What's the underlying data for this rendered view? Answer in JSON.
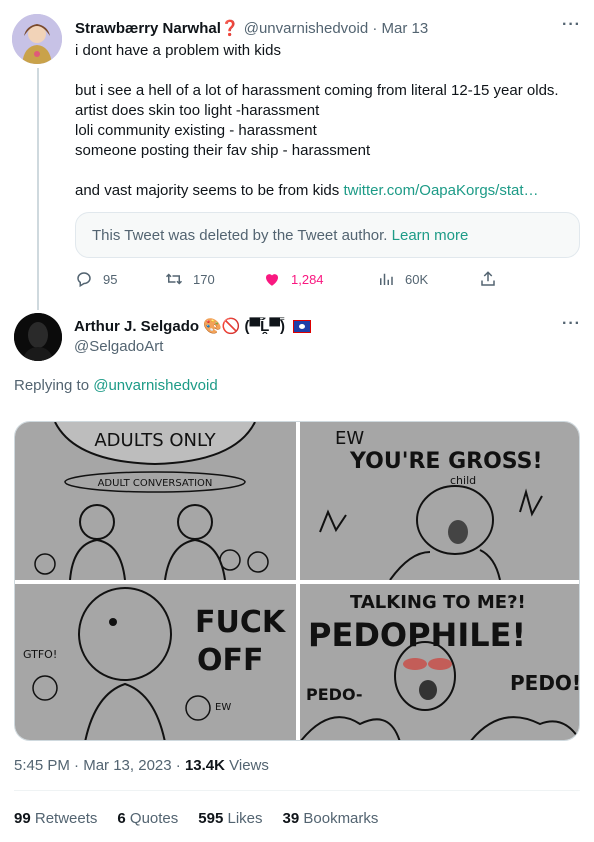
{
  "parent_tweet": {
    "display_name": "Strawbærry Narwhal❓",
    "handle": "@unvarnishedvoid",
    "separator": "·",
    "date": "Mar 13",
    "more_icon": "more-icon",
    "lines": [
      "i dont have a problem with kids",
      "",
      "but i see a hell of a lot of harassment coming from literal 12-15 year olds.",
      "artist does skin too light -harassment",
      "loli community existing - harassment",
      "someone posting their fav ship - harassment",
      ""
    ],
    "last_line_text": "and vast majority seems to be from kids ",
    "last_line_link": "twitter.com/OapaKorgs/stat…",
    "deleted_notice": "This Tweet was deleted by the Tweet author.",
    "learn_more": "Learn more",
    "actions": {
      "replies": "95",
      "retweets": "170",
      "likes": "1,284",
      "views": "60K"
    }
  },
  "main_tweet": {
    "display_name": "Arthur J. Selgado",
    "name_emoji": "🎨🚫 (▀̿Ĺ̯▀̿)",
    "handle": "@SelgadoArt",
    "replying_prefix": "Replying to ",
    "replying_handle": "@unvarnishedvoid",
    "comic_text": {
      "p1_bubble": "ADULTS ONLY",
      "p1_label": "ADULT CONVERSATION",
      "p2_top": "EW",
      "p2_shout": "YOU'RE GROSS!",
      "p2_child": "child",
      "p3_shout_1": "FUCK",
      "p3_shout_2": "OFF",
      "p3_small": "GTFO!",
      "p3_ew": "EW",
      "p4_top": "TALKING TO ME?!",
      "p4_mid": "PEDOPHILE!",
      "p4_left": "PEDO-",
      "p4_right": "PEDO!"
    },
    "time": "5:45 PM",
    "separator": "·",
    "date": "Mar 13, 2023",
    "views_count": "13.4K",
    "views_label": " Views",
    "stats": [
      {
        "count": "99",
        "label": "Retweets"
      },
      {
        "count": "6",
        "label": "Quotes"
      },
      {
        "count": "595",
        "label": "Likes"
      },
      {
        "count": "39",
        "label": "Bookmarks"
      }
    ]
  },
  "colors": {
    "accent_link": "#1d9b87",
    "like": "#f91880",
    "muted": "#536471",
    "panel_gray": "#a6a6a6"
  }
}
